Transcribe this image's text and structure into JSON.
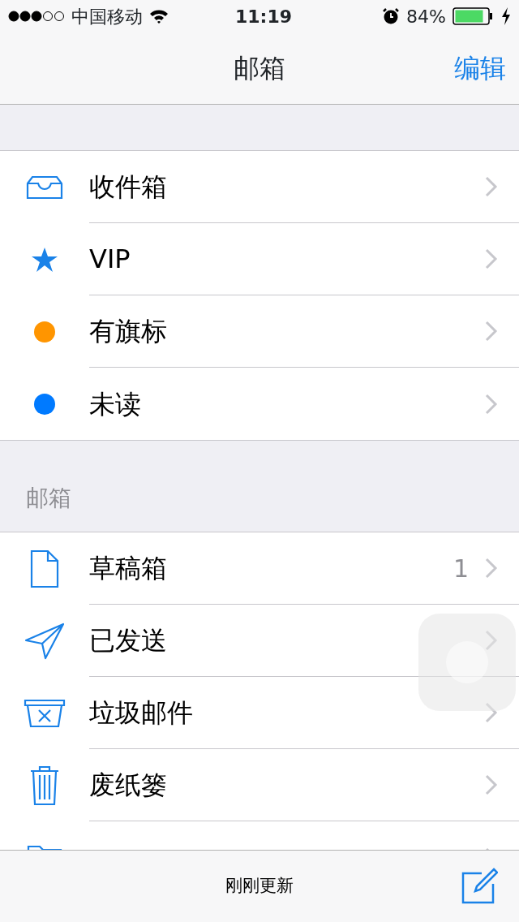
{
  "status_bar": {
    "carrier": "中国移动",
    "time": "11:19",
    "battery": "84%"
  },
  "nav": {
    "title": "邮箱",
    "edit": "编辑"
  },
  "smart_mailboxes": [
    {
      "kind": "inbox",
      "label": "收件箱"
    },
    {
      "kind": "star",
      "label": "VIP"
    },
    {
      "kind": "dot",
      "label": "有旗标",
      "color": "#ff9500"
    },
    {
      "kind": "dot",
      "label": "未读",
      "color": "#007aff"
    }
  ],
  "mailboxes_header": "邮箱",
  "mailboxes": [
    {
      "kind": "draft",
      "label": "草稿箱",
      "count": "1"
    },
    {
      "kind": "sent",
      "label": "已发送"
    },
    {
      "kind": "junk",
      "label": "垃圾邮件"
    },
    {
      "kind": "trash",
      "label": "废纸篓"
    },
    {
      "kind": "folder"
    }
  ],
  "toolbar": {
    "status": "刚刚更新"
  }
}
